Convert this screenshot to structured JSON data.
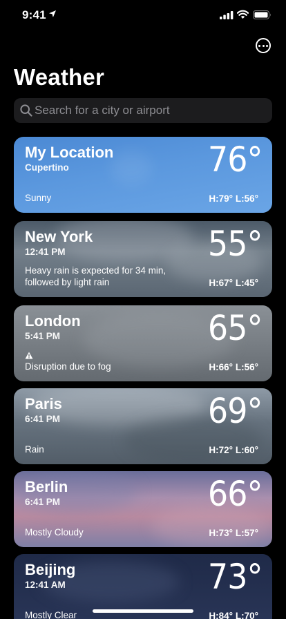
{
  "status_bar": {
    "time": "9:41"
  },
  "header": {
    "title": "Weather"
  },
  "search": {
    "placeholder": "Search for a city or airport"
  },
  "cities": [
    {
      "name": "My Location",
      "subtitle": "Cupertino",
      "temp": "76°",
      "condition": "Sunny",
      "hl": "H:79°  L:56°"
    },
    {
      "name": "New York",
      "subtitle": "12:41 PM",
      "temp": "55°",
      "condition": "Heavy rain is expected for 34 min, followed by light rain",
      "hl": "H:67°  L:45°"
    },
    {
      "name": "London",
      "subtitle": "5:41 PM",
      "temp": "65°",
      "condition": "Disruption due to fog",
      "hl": "H:66°  L:56°"
    },
    {
      "name": "Paris",
      "subtitle": "6:41 PM",
      "temp": "69°",
      "condition": "Rain",
      "hl": "H:72°  L:60°"
    },
    {
      "name": "Berlin",
      "subtitle": "6:41 PM",
      "temp": "66°",
      "condition": "Mostly Cloudy",
      "hl": "H:73°  L:57°"
    },
    {
      "name": "Beijing",
      "subtitle": "12:41 AM",
      "temp": "73°",
      "condition": "Mostly Clear",
      "hl": "H:84°  L:70°"
    }
  ],
  "icons": {
    "status": [
      "location-arrow-icon",
      "cellular-signal-icon",
      "wifi-icon",
      "battery-icon"
    ],
    "more": "ellipsis-circle-icon",
    "search": "magnifying-glass-icon",
    "warning": "warning-triangle-icon"
  }
}
